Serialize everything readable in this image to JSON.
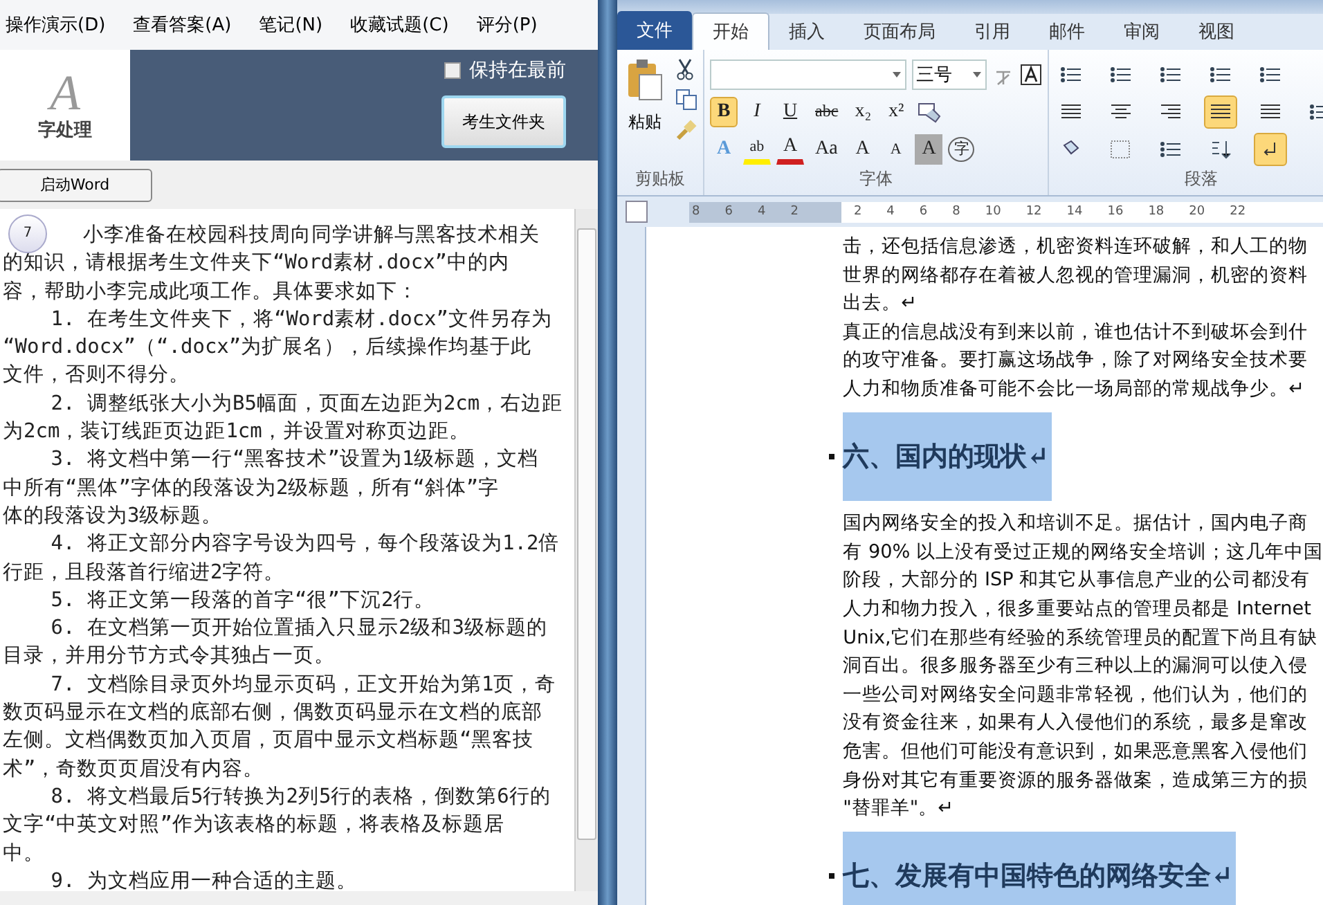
{
  "exam_app": {
    "menu": [
      "操作演示(D)",
      "查看答案(A)",
      "笔记(N)",
      "收藏试题(C)",
      "评分(P)"
    ],
    "logo": {
      "letter": "A",
      "label": "字处理"
    },
    "keep_on_top": {
      "label": "保持在最前",
      "checked": false
    },
    "folder_button": "考生文件夹",
    "launch_button": "启动Word",
    "question": {
      "number": "7",
      "paragraphs": [
        {
          "lines": [
            "小李准备在校园科技周向同学讲解与黑客技术相关",
            "的知识，请根据考生文件夹下“Word素材.docx”中的内",
            "容，帮助小李完成此项工作。具体要求如下："
          ]
        },
        {
          "lines": [
            "1. 在考生文件夹下，将“Word素材.docx”文件另存为",
            "“Word.docx”（“.docx”为扩展名），后续操作均基于此",
            "文件，否则不得分。"
          ]
        },
        {
          "lines": [
            "2. 调整纸张大小为B5幅面，页面左边距为2cm，右边距",
            "为2cm，装订线距页边距1cm，并设置对称页边距。"
          ]
        },
        {
          "lines": [
            "3. 将文档中第一行“黑客技术”设置为1级标题，文档",
            "中所有“黑体”字体的段落设为2级标题，所有“斜体”字",
            "体的段落设为3级标题。"
          ]
        },
        {
          "lines": [
            "4. 将正文部分内容字号设为四号，每个段落设为1.2倍",
            "行距，且段落首行缩进2字符。"
          ]
        },
        {
          "lines": [
            "5. 将正文第一段落的首字“很”下沉2行。"
          ]
        },
        {
          "lines": [
            "6. 在文档第一页开始位置插入只显示2级和3级标题的",
            "目录，并用分节方式令其独占一页。"
          ]
        },
        {
          "lines": [
            "7. 文档除目录页外均显示页码，正文开始为第1页，奇",
            "数页码显示在文档的底部右侧，偶数页码显示在文档的底部",
            "左侧。文档偶数页加入页眉，页眉中显示文档标题“黑客技",
            "术”，奇数页页眉没有内容。"
          ]
        },
        {
          "lines": [
            "8. 将文档最后5行转换为2列5行的表格，倒数第6行的",
            "文字“中英文对照”作为该表格的标题，将表格及标题居",
            "中。"
          ]
        },
        {
          "lines": [
            "9. 为文档应用一种合适的主题。"
          ]
        }
      ]
    }
  },
  "word": {
    "tabs": [
      {
        "label": "文件",
        "kind": "file",
        "selected": false
      },
      {
        "label": "开始",
        "kind": "tab",
        "selected": true
      },
      {
        "label": "插入",
        "kind": "tab",
        "selected": false
      },
      {
        "label": "页面布局",
        "kind": "tab",
        "selected": false
      },
      {
        "label": "引用",
        "kind": "tab",
        "selected": false
      },
      {
        "label": "邮件",
        "kind": "tab",
        "selected": false
      },
      {
        "label": "审阅",
        "kind": "tab",
        "selected": false
      },
      {
        "label": "视图",
        "kind": "tab",
        "selected": false
      }
    ],
    "clipboard": {
      "paste_label": "粘贴",
      "group_label": "剪贴板"
    },
    "font": {
      "size": "三号",
      "group_label": "字体",
      "row2": [
        {
          "label": "B",
          "kind": "bold",
          "active": true
        },
        {
          "label": "I",
          "kind": "italic",
          "active": false
        },
        {
          "label": "U",
          "kind": "underline",
          "active": false
        },
        {
          "label": "abc",
          "kind": "strike",
          "active": false
        },
        {
          "label": "x₂",
          "kind": "plain",
          "active": false
        },
        {
          "label": "x²",
          "kind": "plain",
          "active": false
        }
      ],
      "row3": [
        {
          "label": "A",
          "kind": "effect",
          "active": false
        },
        {
          "label": "ab",
          "kind": "highlight",
          "active": false
        },
        {
          "label": "A",
          "kind": "color",
          "active": false
        },
        {
          "label": "Aa",
          "kind": "plain",
          "active": false
        },
        {
          "label": "A",
          "kind": "plain",
          "active": false
        },
        {
          "label": "A",
          "kind": "small",
          "active": false
        },
        {
          "label": "A",
          "kind": "shade",
          "active": false
        },
        {
          "label": "字",
          "kind": "circle",
          "active": false
        }
      ]
    },
    "paragraph": {
      "group_label": "段落",
      "rows": [
        [
          {
            "kind": "bullets",
            "active": false
          },
          {
            "kind": "numbering",
            "active": false
          },
          {
            "kind": "multilevel",
            "active": false
          },
          {
            "kind": "outdent",
            "active": false
          },
          {
            "kind": "indent",
            "active": false
          }
        ],
        [
          {
            "kind": "left",
            "active": false
          },
          {
            "kind": "center",
            "active": false
          },
          {
            "kind": "right",
            "active": false
          },
          {
            "kind": "justify",
            "active": true
          },
          {
            "kind": "distribute",
            "active": false
          },
          {
            "kind": "spacing",
            "active": false
          }
        ],
        [
          {
            "kind": "shading",
            "active": false
          },
          {
            "kind": "borders",
            "active": false
          },
          {
            "kind": "layout",
            "active": false
          },
          {
            "kind": "sort",
            "active": false
          },
          {
            "kind": "marks",
            "active": true
          }
        ]
      ]
    },
    "ruler": [
      "8",
      "6",
      "4",
      "2",
      "2",
      "4",
      "6",
      "8",
      "10",
      "12",
      "14",
      "16",
      "18",
      "20",
      "22"
    ],
    "document": {
      "blocks": [
        {
          "kind": "text",
          "lines": [
            "击，还包括信息渗透，机密资料连环破解，和人工的物",
            "世界的网络都存在着被人忽视的管理漏洞，机密的资料",
            "出去。↵",
            "真正的信息战没有到来以前，谁也估计不到破坏会到什",
            "的攻守准备。要打赢这场战争，除了对网络安全技术要",
            "人力和物质准备可能不会比一场局部的常规战争少。↵"
          ]
        },
        {
          "kind": "heading",
          "text": "六、国内的现状↵",
          "selected": true
        },
        {
          "kind": "text",
          "lines": [
            "国内网络安全的投入和培训不足。据估计，国内电子商",
            "有 90% 以上没有受过正规的网络安全培训；这几年中国",
            "阶段，大部分的 ISP 和其它从事信息产业的公司都没有",
            "人力和物力投入，很多重要站点的管理员都是 Internet",
            "Unix,它们在那些有经验的系统管理员的配置下尚且有缺",
            "洞百出。很多服务器至少有三种以上的漏洞可以使入侵",
            "一些公司对网络安全问题非常轻视，他们认为，他们的",
            "没有资金往来，如果有人入侵他们的系统，最多是窜改",
            "危害。但他们可能没有意识到，如果恶意黑客入侵他们",
            "身份对其它有重要资源的服务器做案，造成第三方的损",
            "\"替罪羊\"。↵"
          ]
        },
        {
          "kind": "heading",
          "text": "七、发展有中国特色的网络安全↵",
          "selected": true
        }
      ]
    }
  }
}
